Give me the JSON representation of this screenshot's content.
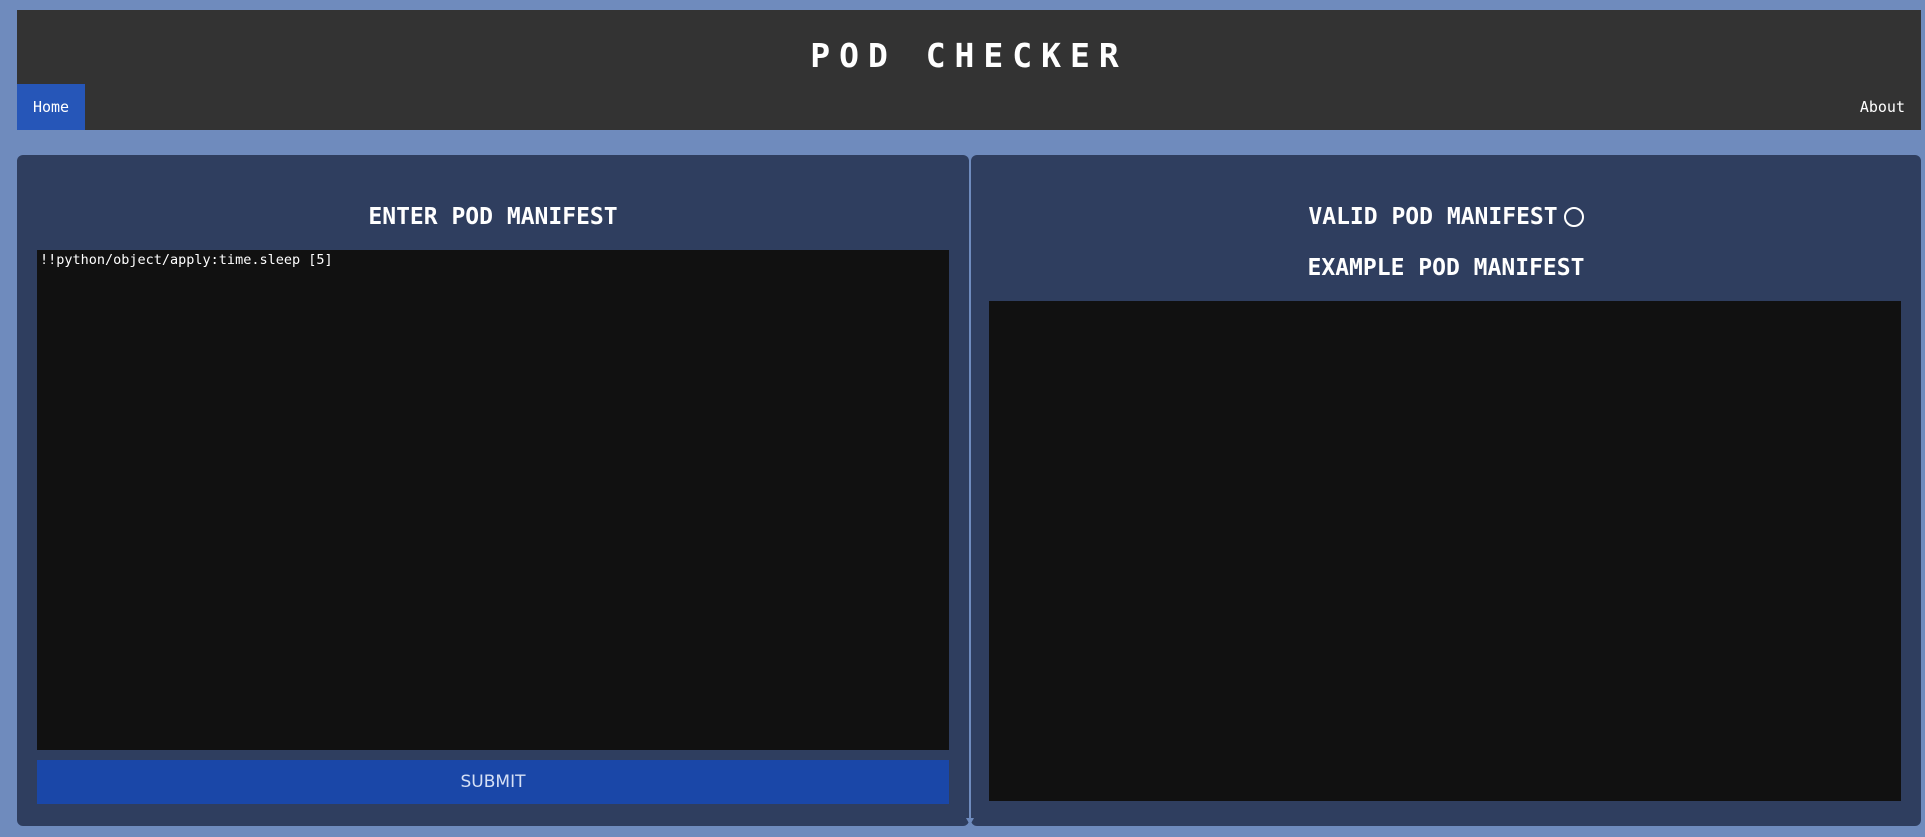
{
  "app": {
    "title": "POD CHECKER"
  },
  "nav": {
    "home_label": "Home",
    "about_label": "About",
    "active": "Home"
  },
  "editor": {
    "heading": "ENTER POD MANIFEST",
    "input_value": "!!python/object/apply:time.sleep [5]",
    "submit_label": "SUBMIT"
  },
  "result": {
    "valid_heading": "VALID POD MANIFEST",
    "valid_status_icon": "empty-circle-icon",
    "example_heading": "EXAMPLE POD MANIFEST",
    "example_content": ""
  },
  "colors": {
    "page_background": "#6f8bbd",
    "header_background": "#333333",
    "panel_background": "#2f3e5f",
    "editor_background": "#111111",
    "active_nav": "#2656b8",
    "submit_button": "#1a47a8"
  }
}
